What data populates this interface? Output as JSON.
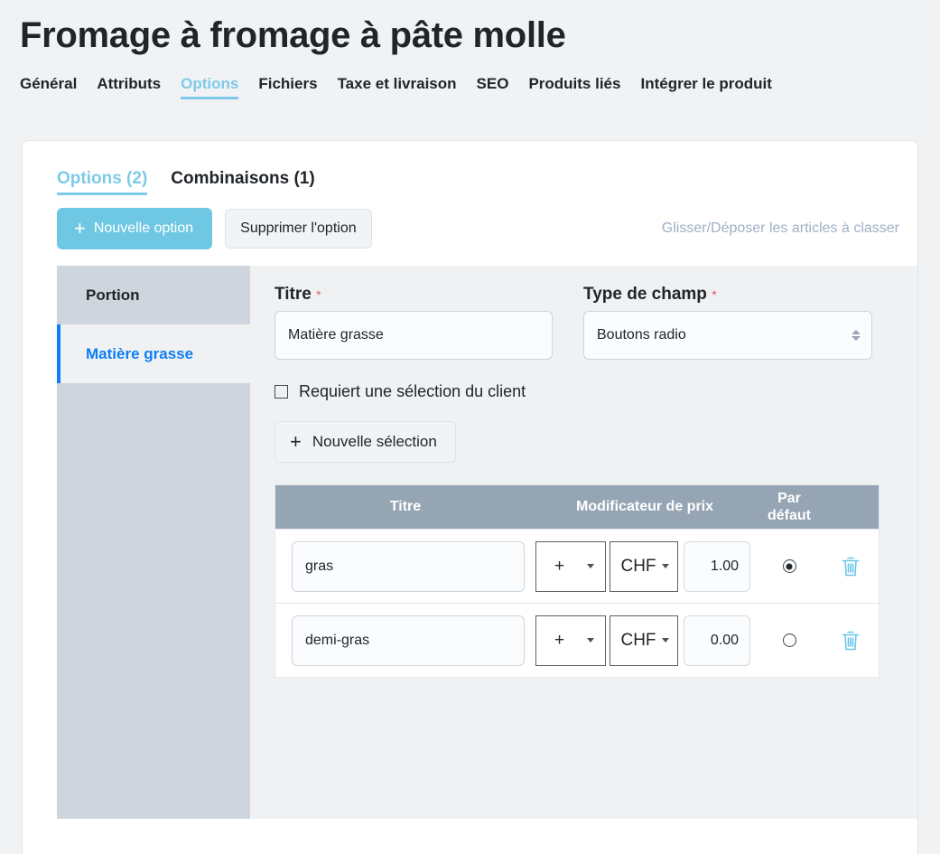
{
  "page": {
    "title": "Fromage à fromage à pâte molle"
  },
  "main_tabs": [
    {
      "label": "Général",
      "active": false
    },
    {
      "label": "Attributs",
      "active": false
    },
    {
      "label": "Options",
      "active": true
    },
    {
      "label": "Fichiers",
      "active": false
    },
    {
      "label": "Taxe et livraison",
      "active": false
    },
    {
      "label": "SEO",
      "active": false
    },
    {
      "label": "Produits liés",
      "active": false
    },
    {
      "label": "Intégrer le produit",
      "active": false
    }
  ],
  "sub_tabs": [
    {
      "label": "Options (2)",
      "active": true
    },
    {
      "label": "Combinaisons (1)",
      "active": false
    }
  ],
  "toolbar": {
    "new_option_label": "Nouvelle option",
    "delete_option_label": "Supprimer l'option",
    "dnd_hint": "Glisser/Déposer les articles à classer",
    "plus_glyph": "+"
  },
  "option_list": [
    {
      "label": "Portion",
      "active": false
    },
    {
      "label": "Matière grasse",
      "active": true
    }
  ],
  "detail": {
    "title_label": "Titre",
    "title_required_mark": "*",
    "title_value": "Matière grasse",
    "field_type_label": "Type de champ",
    "field_type_required_mark": "*",
    "field_type_value": "Boutons radio",
    "require_selection_label": "Requiert une sélection du client",
    "require_selection_checked": false,
    "new_selection_label": "Nouvelle sélection",
    "new_selection_plus": "+"
  },
  "selection_table": {
    "headers": {
      "title": "Titre",
      "price_modifier": "Modificateur de prix",
      "default_line1": "Par",
      "default_line2": "défaut",
      "delete": ""
    },
    "rows": [
      {
        "title": "gras",
        "operator": "+",
        "currency": "CHF",
        "amount": "1.00",
        "is_default": true,
        "delete_icon": "trash-icon"
      },
      {
        "title": "demi-gras",
        "operator": "+",
        "currency": "CHF",
        "amount": "0.00",
        "is_default": false,
        "delete_icon": "trash-icon"
      }
    ]
  },
  "colors": {
    "accent": "#6fc8e3",
    "active_link": "#0d7ef5",
    "table_header_bg": "#95a5b4",
    "page_bg": "#f1f2f4",
    "required": "#e05b5b",
    "trash": "#6ec6ea"
  }
}
